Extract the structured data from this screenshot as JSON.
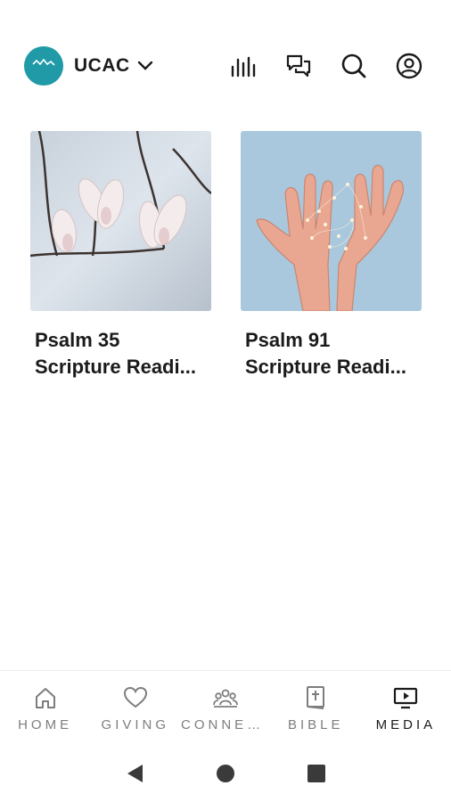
{
  "header": {
    "org_name": "UCAC",
    "logo_text": "UCAC",
    "icons": [
      "audio-bars-icon",
      "chat-bubbles-icon",
      "search-icon",
      "account-icon"
    ]
  },
  "media": {
    "items": [
      {
        "title_line1": "Psalm 35",
        "title_line2": "Scripture Readi..."
      },
      {
        "title_line1": "Psalm 91",
        "title_line2": "Scripture Readi..."
      }
    ]
  },
  "bottom_nav": {
    "items": [
      {
        "label": "HOME",
        "icon": "home-icon"
      },
      {
        "label": "GIVING",
        "icon": "heart-icon"
      },
      {
        "label": "CONNEC...",
        "icon": "people-icon"
      },
      {
        "label": "BIBLE",
        "icon": "bible-icon"
      },
      {
        "label": "MEDIA",
        "icon": "tv-play-icon"
      }
    ],
    "active": "MEDIA"
  },
  "colors": {
    "brand": "#1f9aa6",
    "text": "#1b1b1b",
    "muted": "#7d7d7d"
  }
}
